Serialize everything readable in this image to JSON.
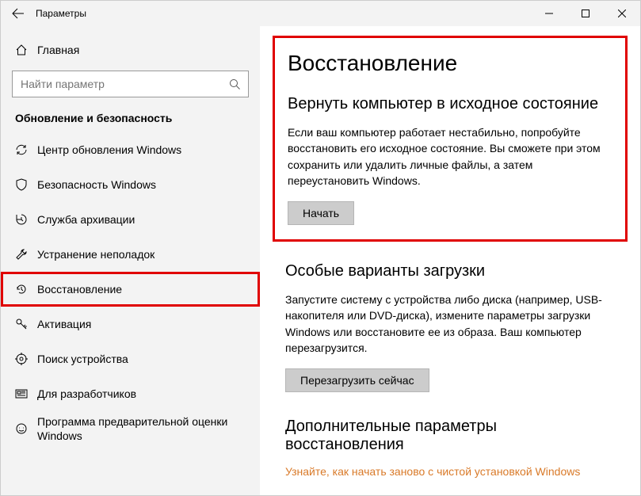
{
  "window": {
    "title": "Параметры"
  },
  "sidebar": {
    "home_label": "Главная",
    "search_placeholder": "Найти параметр",
    "section_title": "Обновление и безопасность",
    "items": [
      {
        "label": "Центр обновления Windows"
      },
      {
        "label": "Безопасность Windows"
      },
      {
        "label": "Служба архивации"
      },
      {
        "label": "Устранение неполадок"
      },
      {
        "label": "Восстановление"
      },
      {
        "label": "Активация"
      },
      {
        "label": "Поиск устройства"
      },
      {
        "label": "Для разработчиков"
      },
      {
        "label": "Программа предварительной оценки Windows"
      }
    ]
  },
  "main": {
    "title": "Восстановление",
    "sections": [
      {
        "heading": "Вернуть компьютер в исходное состояние",
        "desc": "Если ваш компьютер работает нестабильно, попробуйте восстановить его исходное состояние. Вы сможете при этом сохранить или удалить личные файлы, а затем переустановить Windows.",
        "button": "Начать"
      },
      {
        "heading": "Особые варианты загрузки",
        "desc": "Запустите систему с устройства либо диска (например, USB-накопителя или DVD-диска), измените параметры загрузки Windows или восстановите ее из образа. Ваш компьютер перезагрузится.",
        "button": "Перезагрузить сейчас"
      }
    ],
    "more_heading": "Дополнительные параметры восстановления",
    "more_link": "Узнайте, как начать заново с чистой установкой Windows"
  }
}
